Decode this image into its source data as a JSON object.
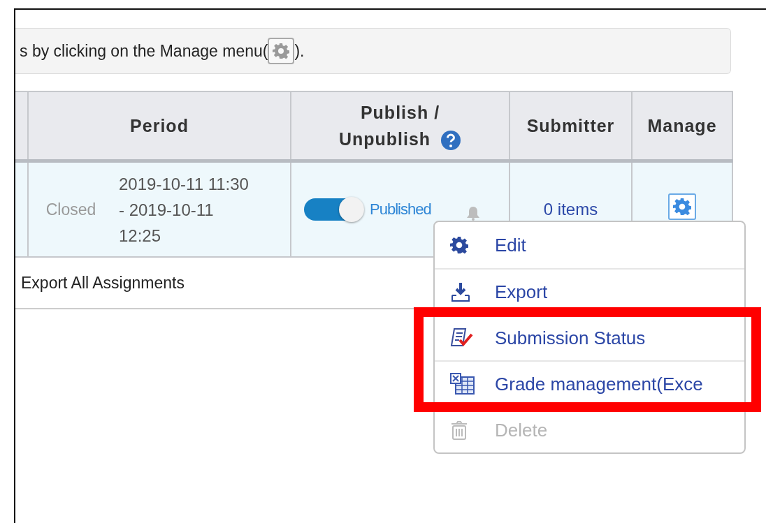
{
  "notice": {
    "text_before": "s by clicking on the Manage menu(",
    "text_after": ")."
  },
  "table": {
    "columns": [
      {
        "label": "Period",
        "help": false
      },
      {
        "label": "Publish / Unpublish",
        "help": true
      },
      {
        "label": "Submitter",
        "help": false
      },
      {
        "label": "Manage",
        "help": false
      }
    ],
    "rows": [
      {
        "status": "Closed",
        "period": "2019-10-11 11:30 - 2019-10-11 12:25",
        "published": true,
        "publish_label": "Published",
        "submitter": "0 items"
      }
    ]
  },
  "footer_link": "Export All Assignments",
  "menu": {
    "items": [
      {
        "label": "Edit",
        "kind": "gear",
        "disabled": false,
        "highlighted": false
      },
      {
        "label": "Export",
        "kind": "download",
        "disabled": false,
        "highlighted": false
      },
      {
        "label": "Submission Status",
        "kind": "checklist",
        "disabled": false,
        "highlighted": true
      },
      {
        "label": "Grade management(Exce",
        "kind": "spreadsheet",
        "disabled": false,
        "highlighted": true
      },
      {
        "label": "Delete",
        "kind": "trash",
        "disabled": true,
        "highlighted": false
      }
    ]
  }
}
